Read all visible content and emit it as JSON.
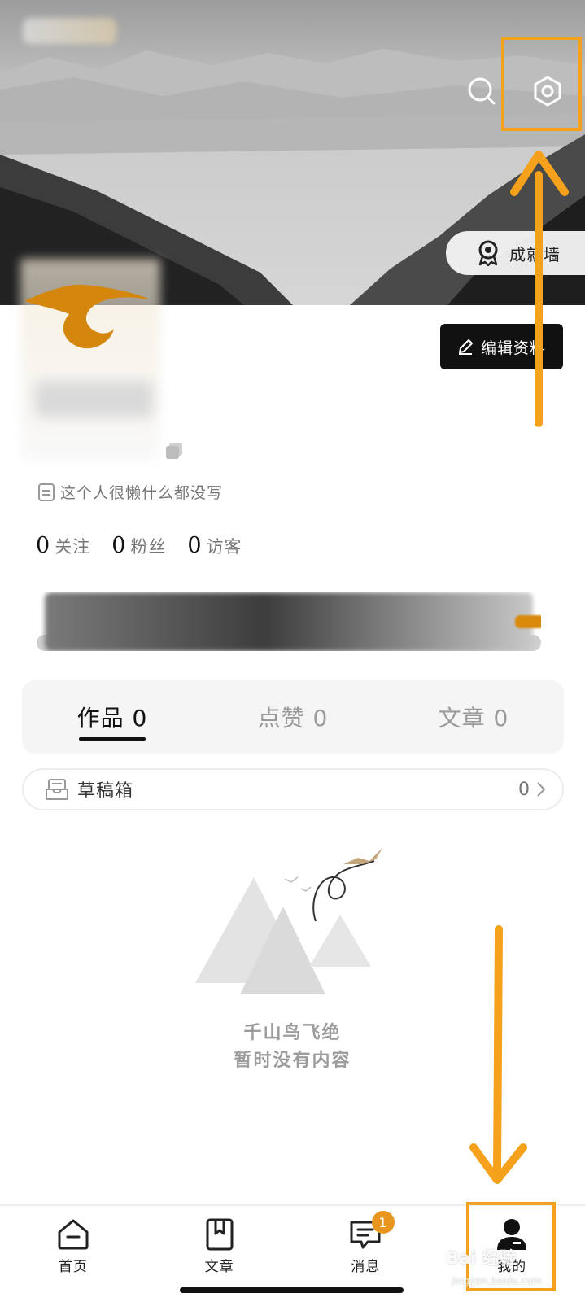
{
  "header": {
    "search_icon": "search-icon",
    "settings_icon": "gear-icon",
    "honor_wall_label": "成就墙"
  },
  "profile": {
    "edit_label": "编辑资料",
    "bio": "这个人很懒什么都没写",
    "stats": [
      {
        "num": "0",
        "label": "关注"
      },
      {
        "num": "0",
        "label": "粉丝"
      },
      {
        "num": "0",
        "label": "访客"
      }
    ]
  },
  "tabs": [
    {
      "label": "作品 0",
      "active": true
    },
    {
      "label": "点赞 0",
      "active": false
    },
    {
      "label": "文章 0",
      "active": false
    }
  ],
  "drafts": {
    "label": "草稿箱",
    "count": "0"
  },
  "empty_state": {
    "line1": "千山鸟飞绝",
    "line2": "暂时没有内容"
  },
  "nav": [
    {
      "label": "首页",
      "icon": "home-icon"
    },
    {
      "label": "文章",
      "icon": "bookmark-book-icon"
    },
    {
      "label": "消息",
      "icon": "message-icon",
      "badge": "1"
    },
    {
      "label": "我的",
      "icon": "profile-icon",
      "active": true
    }
  ],
  "watermark": {
    "text": "Bai 经验",
    "url": "jingyan.baidu.com"
  },
  "colors": {
    "highlight": "#f5a11c",
    "badge": "#e9961f",
    "dark_button": "#111111"
  }
}
